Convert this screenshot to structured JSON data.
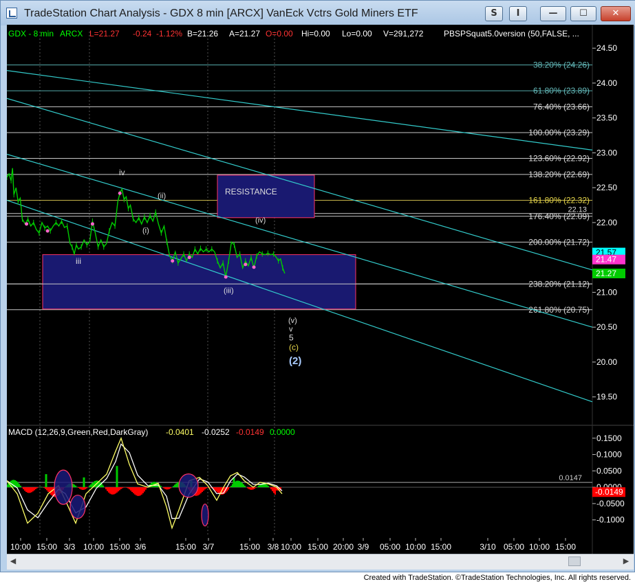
{
  "window": {
    "title": "TradeStation Chart Analysis - GDX 8 min [ARCX] VanEck Vctrs Gold Miners ETF",
    "buttons": [
      {
        "name": "study-button",
        "label": "S"
      },
      {
        "name": "indicator-button",
        "label": "I"
      },
      {
        "name": "minimize-button",
        "label": "—"
      },
      {
        "name": "maximize-button",
        "label": "☐"
      },
      {
        "name": "close-button",
        "label": "✕"
      }
    ]
  },
  "footer": "Created with TradeStation. ©TradeStation Technologies, Inc. All rights reserved.",
  "header": {
    "symbol": "GDX - 8 min",
    "exchange": "ARCX",
    "last": "L=21.27",
    "change": "-0.24",
    "change_pct": "-1.12%",
    "bid": "B=21.26",
    "ask": "A=21.27",
    "open": "O=0.00",
    "high": "Hi=0.00",
    "low": "Lo=0.00",
    "volume": "V=291,272",
    "study": "PBSPSquat5.0version (50,FALSE, ..."
  },
  "macd_header": {
    "label": "MACD (12,26,9,Green,Red,DarkGray)",
    "v1": "-0.0401",
    "v2": "-0.0252",
    "v3": "-0.0149",
    "v4": "0.0000"
  },
  "chart_data": [
    {
      "type": "line",
      "title": "GDX - 8 min",
      "xlabel": "",
      "ylabel": "",
      "ylim": [
        19.3,
        24.6
      ],
      "x_tick_labels": [
        "10:00",
        "15:00",
        "3/3",
        "10:00",
        "15:00",
        "3/6",
        "15:00",
        "3/7",
        "15:00",
        "3/8",
        "10:00",
        "15:00",
        "20:00",
        "3/9",
        "05:00",
        "10:00",
        "15:00",
        "3/10",
        "05:00",
        "10:00",
        "15:00"
      ],
      "y_tick_labels": [
        "24.50",
        "24.00",
        "23.50",
        "23.00",
        "22.50",
        "22.00",
        "21.50",
        "21.00",
        "20.50",
        "20.00",
        "19.50"
      ],
      "price_badges": {
        "last": "21.57",
        "prev": "21.47",
        "current": "21.27"
      },
      "fib_levels": [
        {
          "label": "38.20% (24.26)",
          "price": 24.26
        },
        {
          "label": "61.80% (23.89)",
          "price": 23.89
        },
        {
          "label": "76.40% (23.66)",
          "price": 23.66
        },
        {
          "label": "100.00% (23.29)",
          "price": 23.29
        },
        {
          "label": "123.60% (22.92)",
          "price": 22.92
        },
        {
          "label": "138.20% (22.69)",
          "price": 22.69
        },
        {
          "label": "161.80% (22.32)",
          "price": 22.32
        },
        {
          "label": "176.40% (22.09)",
          "price": 22.09
        },
        {
          "label": "200.00% (21.72)",
          "price": 21.72
        },
        {
          "label": "238.20% (21.12)",
          "price": 21.12
        },
        {
          "label": "261.80% (20.75)",
          "price": 20.75
        }
      ],
      "extra_level": {
        "label": "22.13",
        "price": 22.13
      },
      "zones": [
        {
          "label": "RESISTANCE",
          "top": 22.68,
          "bottom": 22.07
        },
        {
          "label": "",
          "top": 21.54,
          "bottom": 20.76
        }
      ],
      "wave_labels": [
        "iv",
        "(ii)",
        "(i)",
        "iii",
        "(iv)",
        "(iii)",
        "(v)",
        "v",
        "5",
        "(c)",
        "(2)"
      ],
      "series": [
        {
          "values": [
            {
              "x": 0,
              "y": 22.65
            },
            {
              "x": 3,
              "y": 22.7
            },
            {
              "x": 6,
              "y": 22.6
            },
            {
              "x": 8,
              "y": 22.78
            },
            {
              "x": 10,
              "y": 22.4
            },
            {
              "x": 13,
              "y": 22.5
            },
            {
              "x": 16,
              "y": 22.3
            },
            {
              "x": 19,
              "y": 22.35
            },
            {
              "x": 22,
              "y": 22.05
            },
            {
              "x": 26,
              "y": 21.98
            },
            {
              "x": 30,
              "y": 22.05
            },
            {
              "x": 34,
              "y": 21.95
            },
            {
              "x": 38,
              "y": 22.0
            },
            {
              "x": 42,
              "y": 21.9
            },
            {
              "x": 46,
              "y": 21.85
            },
            {
              "x": 50,
              "y": 22.0
            },
            {
              "x": 54,
              "y": 21.92
            },
            {
              "x": 58,
              "y": 21.95
            },
            {
              "x": 62,
              "y": 21.88
            },
            {
              "x": 66,
              "y": 21.95
            },
            {
              "x": 70,
              "y": 22.0
            },
            {
              "x": 74,
              "y": 21.95
            },
            {
              "x": 78,
              "y": 22.02
            },
            {
              "x": 82,
              "y": 21.93
            },
            {
              "x": 86,
              "y": 21.95
            },
            {
              "x": 90,
              "y": 21.7
            },
            {
              "x": 93,
              "y": 21.65
            },
            {
              "x": 96,
              "y": 21.55
            },
            {
              "x": 99,
              "y": 21.68
            },
            {
              "x": 102,
              "y": 21.62
            },
            {
              "x": 106,
              "y": 21.65
            },
            {
              "x": 110,
              "y": 21.75
            },
            {
              "x": 114,
              "y": 21.68
            },
            {
              "x": 118,
              "y": 21.72
            },
            {
              "x": 122,
              "y": 22.02
            },
            {
              "x": 126,
              "y": 21.85
            },
            {
              "x": 130,
              "y": 21.65
            },
            {
              "x": 134,
              "y": 21.75
            },
            {
              "x": 138,
              "y": 21.65
            },
            {
              "x": 142,
              "y": 21.7
            },
            {
              "x": 146,
              "y": 21.88
            },
            {
              "x": 150,
              "y": 22.0
            },
            {
              "x": 154,
              "y": 21.95
            },
            {
              "x": 158,
              "y": 22.3
            },
            {
              "x": 161,
              "y": 22.42
            },
            {
              "x": 164,
              "y": 22.48
            },
            {
              "x": 167,
              "y": 22.33
            },
            {
              "x": 170,
              "y": 22.37
            },
            {
              "x": 173,
              "y": 22.2
            },
            {
              "x": 176,
              "y": 22.25
            },
            {
              "x": 180,
              "y": 22.05
            },
            {
              "x": 184,
              "y": 22.0
            },
            {
              "x": 188,
              "y": 22.07
            },
            {
              "x": 192,
              "y": 21.98
            },
            {
              "x": 196,
              "y": 22.08
            },
            {
              "x": 200,
              "y": 22.0
            },
            {
              "x": 204,
              "y": 22.1
            },
            {
              "x": 208,
              "y": 22.02
            },
            {
              "x": 212,
              "y": 22.15
            },
            {
              "x": 216,
              "y": 21.98
            },
            {
              "x": 220,
              "y": 21.85
            },
            {
              "x": 224,
              "y": 21.95
            },
            {
              "x": 228,
              "y": 21.72
            },
            {
              "x": 232,
              "y": 21.52
            },
            {
              "x": 236,
              "y": 21.45
            },
            {
              "x": 240,
              "y": 21.58
            },
            {
              "x": 244,
              "y": 21.42
            },
            {
              "x": 248,
              "y": 21.48
            },
            {
              "x": 252,
              "y": 21.55
            },
            {
              "x": 256,
              "y": 21.45
            },
            {
              "x": 260,
              "y": 21.55
            },
            {
              "x": 264,
              "y": 21.5
            },
            {
              "x": 268,
              "y": 21.62
            },
            {
              "x": 272,
              "y": 21.55
            },
            {
              "x": 276,
              "y": 21.63
            },
            {
              "x": 280,
              "y": 21.58
            },
            {
              "x": 284,
              "y": 21.62
            },
            {
              "x": 288,
              "y": 21.58
            },
            {
              "x": 292,
              "y": 21.62
            },
            {
              "x": 296,
              "y": 21.58
            },
            {
              "x": 300,
              "y": 21.45
            },
            {
              "x": 304,
              "y": 21.35
            },
            {
              "x": 308,
              "y": 21.42
            },
            {
              "x": 312,
              "y": 21.22
            },
            {
              "x": 316,
              "y": 21.45
            },
            {
              "x": 320,
              "y": 21.72
            },
            {
              "x": 324,
              "y": 21.68
            },
            {
              "x": 328,
              "y": 21.5
            },
            {
              "x": 332,
              "y": 21.55
            },
            {
              "x": 336,
              "y": 21.35
            },
            {
              "x": 340,
              "y": 21.45
            },
            {
              "x": 344,
              "y": 21.38
            },
            {
              "x": 348,
              "y": 21.5
            },
            {
              "x": 352,
              "y": 21.35
            },
            {
              "x": 356,
              "y": 21.52
            },
            {
              "x": 360,
              "y": 21.58
            },
            {
              "x": 364,
              "y": 21.55
            },
            {
              "x": 368,
              "y": 21.54
            },
            {
              "x": 372,
              "y": 21.56
            },
            {
              "x": 376,
              "y": 21.54
            },
            {
              "x": 380,
              "y": 21.55
            },
            {
              "x": 384,
              "y": 21.5
            },
            {
              "x": 387,
              "y": 21.45
            },
            {
              "x": 390,
              "y": 21.48
            },
            {
              "x": 393,
              "y": 21.35
            },
            {
              "x": 396,
              "y": 21.27
            }
          ]
        }
      ]
    },
    {
      "type": "line",
      "title": "MACD (12,26,9,Green,Red,DarkGray)",
      "xlabel": "",
      "ylabel": "",
      "ylim": [
        -0.13,
        0.16
      ],
      "y_tick_labels": [
        "0.1500",
        "0.1000",
        "0.0500",
        "0.0000",
        "-0.0500",
        "-0.1000"
      ],
      "price_badges": {
        "last": "0.0147",
        "current": "-0.0149"
      }
    }
  ],
  "colors": {
    "background": "#000000",
    "price": "#00cc00",
    "trendline": "#33cccc",
    "zone_fill": "#191970",
    "zone_border": "#ff3366",
    "label_fib": "#cccccc",
    "label_yellow": "#e8d84a",
    "macd_line": "#ffff66",
    "macd_signal": "#ffffff",
    "hist_pos": "#00cc00",
    "hist_neg": "#ff0000",
    "badge_cyan": "#00ffff",
    "badge_magenta": "#ff33cc",
    "badge_green": "#00cc00"
  }
}
